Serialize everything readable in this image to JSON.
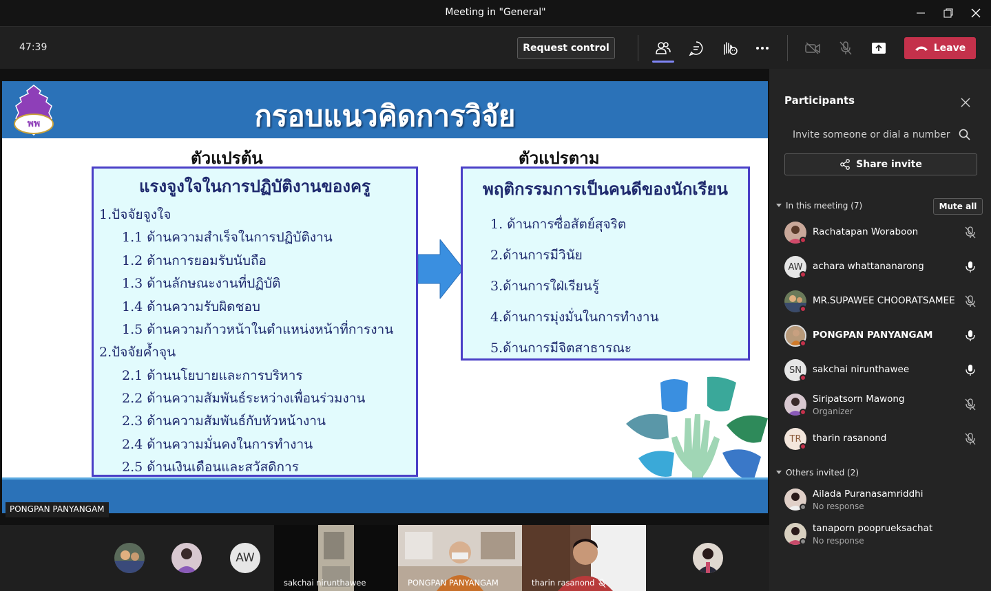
{
  "window": {
    "title": "Meeting in \"General\""
  },
  "toolbar": {
    "timer": "47:39",
    "request_control": "Request control",
    "leave": "Leave"
  },
  "slide": {
    "title": "กรอบแนวคิดการวิจัย",
    "independent_label": "ตัวแปรต้น",
    "dependent_label": "ตัวแปรตาม",
    "left_box": {
      "heading": "แรงจูงใจในการปฏิบัติงานของครู",
      "lines": [
        "1.ปัจจัยจูงใจ",
        "1.1 ด้านความสำเร็จในการปฏิบัติงาน",
        "1.2 ด้านการยอมรับนับถือ",
        "1.3 ด้านลักษณะงานที่ปฏิบัติ",
        "1.4 ด้านความรับผิดชอบ",
        "1.5 ด้านความก้าวหน้าในตำแหน่งหน้าที่การงาน",
        "2.ปัจจัยค้ำจุน",
        "2.1 ด้านนโยบายและการบริหาร",
        "2.2 ด้านความสัมพันธ์ระหว่างเพื่อนร่วมงาน",
        "2.3 ด้านความสัมพันธ์กับหัวหน้างาน",
        "2.4 ด้านความมั่นคงในการทำงาน",
        "2.5 ด้านเงินเดือนและสวัสดิการ"
      ]
    },
    "right_box": {
      "heading": "พฤติกรรมการเป็นคนดีของนักเรียน",
      "lines": [
        "1. ด้านการซื่อสัตย์สุจริต",
        "2.ด้านการมีวินัย",
        "3.ด้านการใฝ่เรียนรู้",
        "4.ด้านการมุ่งมั่นในการทำงาน",
        "5.ด้านการมีจิตสาธารณะ"
      ]
    },
    "presenter": "PONGPAN PANYANGAM"
  },
  "panel": {
    "title": "Participants",
    "invite_placeholder": "Invite someone or dial a number",
    "share_invite": "Share invite",
    "in_meeting": "In this meeting (7)",
    "mute_all": "Mute all",
    "others_invited": "Others invited (2)",
    "participants": [
      {
        "name": "Rachatapan Woraboon",
        "initials": "",
        "sub": "",
        "mic": "muted"
      },
      {
        "name": "achara whattananarong",
        "initials": "AW",
        "sub": "",
        "mic": "on"
      },
      {
        "name": "MR.SUPAWEE CHOORATSAMEE",
        "initials": "",
        "sub": "",
        "mic": "muted"
      },
      {
        "name": "PONGPAN PANYANGAM",
        "initials": "",
        "sub": "",
        "mic": "on"
      },
      {
        "name": "sakchai nirunthawee",
        "initials": "SN",
        "sub": "",
        "mic": "on"
      },
      {
        "name": "Siripatsorn Mawong",
        "initials": "",
        "sub": "Organizer",
        "mic": "muted"
      },
      {
        "name": "tharin rasanond",
        "initials": "TR",
        "sub": "",
        "mic": "muted"
      }
    ],
    "invited": [
      {
        "name": "Ailada Puranasamriddhi",
        "sub": "No response"
      },
      {
        "name": "tanaporn pooprueksachat",
        "sub": "No response"
      }
    ]
  },
  "gallery": {
    "avatar_initials": "AW",
    "tiles": [
      {
        "name": "sakchai nirunthawee"
      },
      {
        "name": "PONGPAN PANYANGAM"
      },
      {
        "name": "tharin rasanond"
      }
    ]
  },
  "colors": {
    "leave": "#c4314b",
    "accent": "#7f85f5",
    "slide_blue": "#2b72b8",
    "box_border": "#4a3fc7",
    "box_fill": "#e2fbfd"
  }
}
